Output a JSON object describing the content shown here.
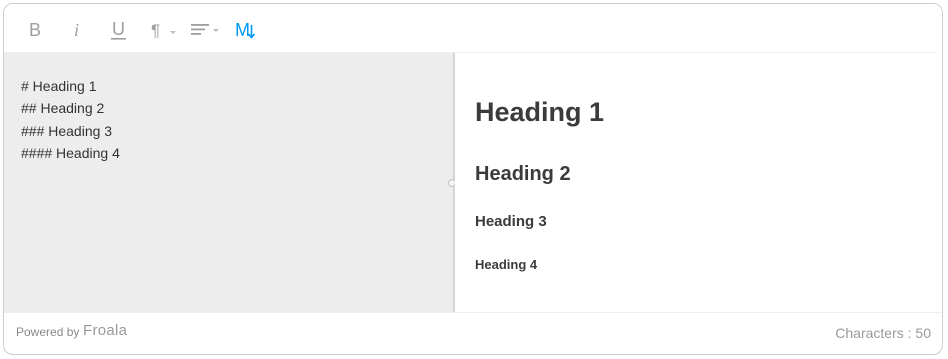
{
  "toolbar": {
    "buttons": [
      {
        "name": "bold",
        "icon": "bold-icon",
        "label": "B"
      },
      {
        "name": "italic",
        "icon": "italic-icon",
        "label": "i"
      },
      {
        "name": "underline",
        "icon": "underline-icon",
        "label": "U"
      },
      {
        "name": "paragraph-format",
        "icon": "paragraph-icon",
        "label": "¶"
      },
      {
        "name": "align",
        "icon": "align-left-icon"
      },
      {
        "name": "markdown",
        "icon": "markdown-icon",
        "label": "M",
        "active": true
      }
    ],
    "icon_color": "#9e9e9e",
    "active_color": "#0098f7"
  },
  "markdown_source": {
    "lines": [
      "# Heading 1",
      "## Heading 2",
      "### Heading 3",
      "#### Heading 4"
    ]
  },
  "preview": {
    "h1": "Heading 1",
    "h2": "Heading 2",
    "h3": "Heading 3",
    "h4": "Heading 4"
  },
  "footer": {
    "powered_by": "Powered by",
    "brand": "Froala",
    "character_count": "Characters : 50"
  },
  "colors": {
    "markdown_pane_bg": "#ededed",
    "heading_text": "#3b3b3b"
  }
}
